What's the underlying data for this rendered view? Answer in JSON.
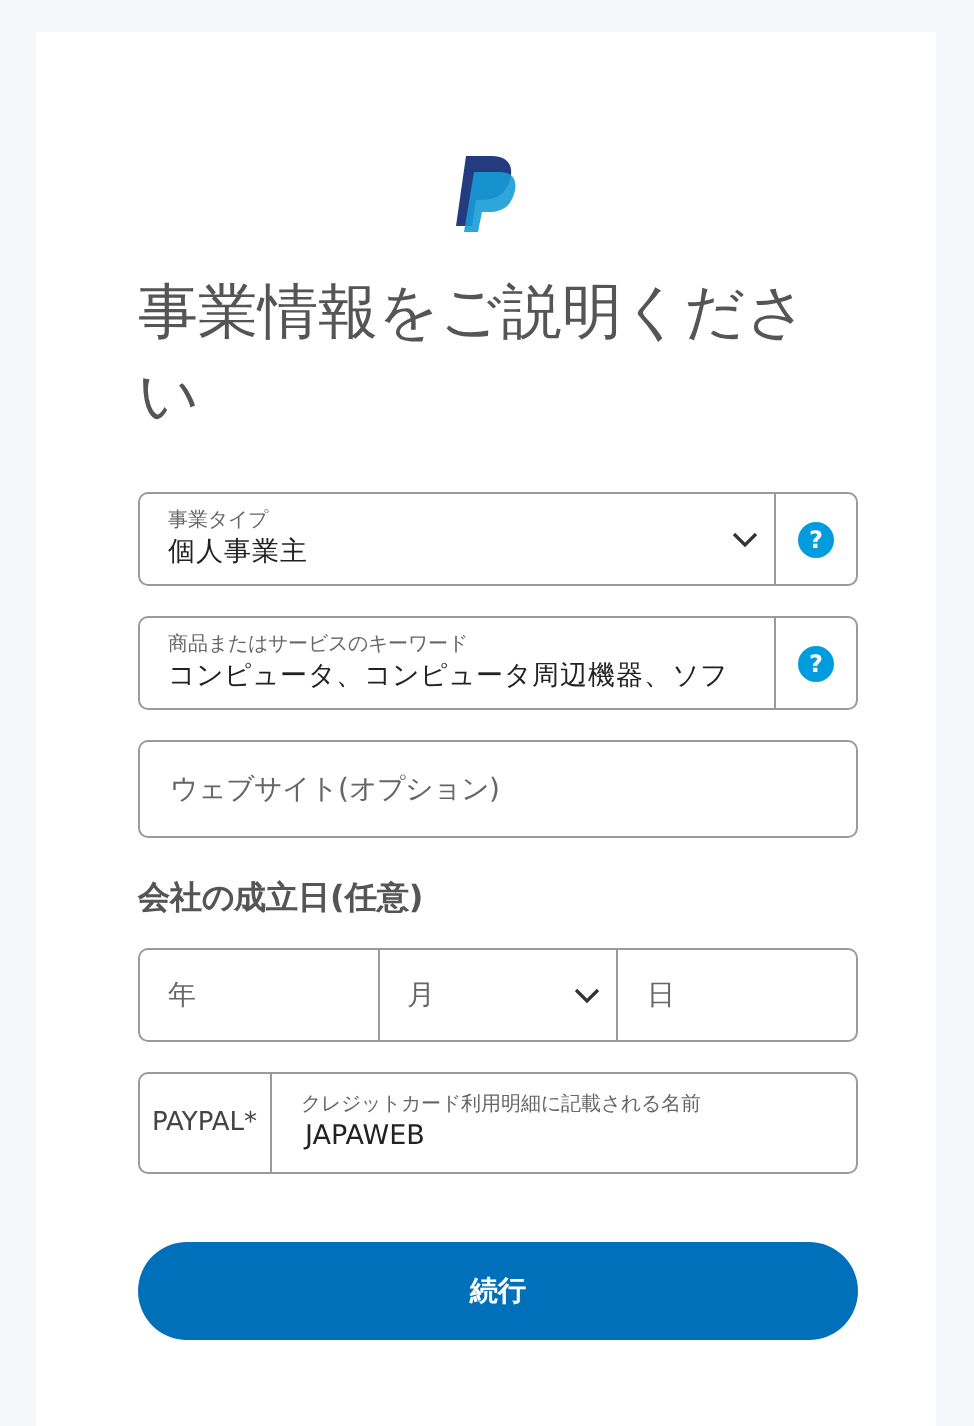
{
  "title": "事業情報をご説明ください",
  "fields": [
    {
      "kind": "select",
      "label": "事業タイプ",
      "value": "個人事業主",
      "help": "?"
    },
    {
      "kind": "text",
      "label": "商品またはサービスのキーワード",
      "value": "コンピュータ、コンピュータ周辺機器、ソフ",
      "help": "?"
    },
    {
      "kind": "empty",
      "placeholder": "ウェブサイト(オプション)"
    }
  ],
  "date_section": {
    "heading": "会社の成立日(任意)",
    "fields": [
      {
        "kind": "text",
        "placeholder": "年"
      },
      {
        "kind": "select",
        "placeholder": "月"
      },
      {
        "kind": "text",
        "placeholder": "日"
      }
    ]
  },
  "descriptor": {
    "prefix": "PAYPAL*",
    "label": "クレジットカード利用明細に記載される名前",
    "value": "JAPAWEB"
  },
  "button": "続行"
}
